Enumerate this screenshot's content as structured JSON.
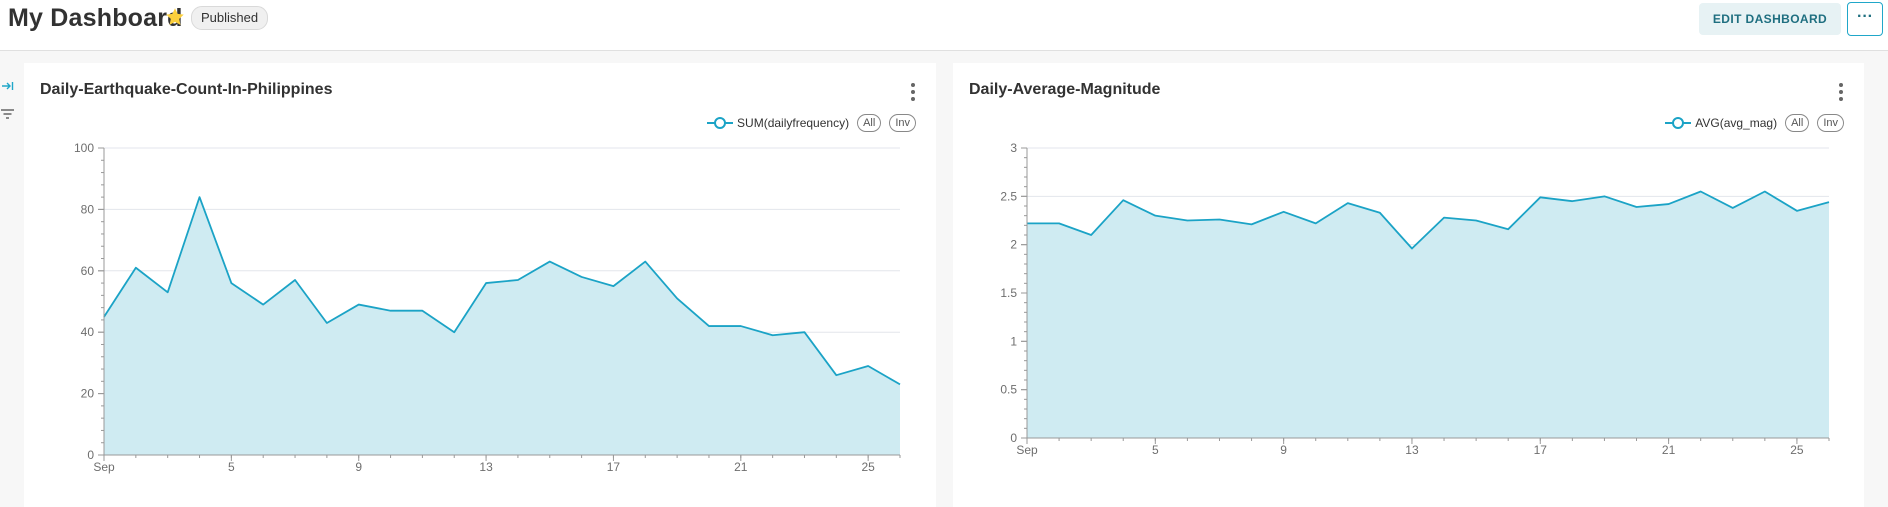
{
  "header": {
    "title": "My Dashboard",
    "status_badge": "Published",
    "edit_button": "EDIT DASHBOARD",
    "more_button": "···"
  },
  "colors": {
    "line": "#1ba3c6",
    "area": "#cfebf2",
    "star": "#fccf3c",
    "grid": "#e3e6ec"
  },
  "chart_data": [
    {
      "type": "area",
      "title": "Daily-Earthquake-Count-In-Philippines",
      "legend": {
        "series": "SUM(dailyfrequency)",
        "all_label": "All",
        "inv_label": "Inv",
        "placement": "top-right"
      },
      "x": [
        "Sep 1",
        "Sep 2",
        "Sep 3",
        "Sep 4",
        "Sep 5",
        "Sep 6",
        "Sep 7",
        "Sep 8",
        "Sep 9",
        "Sep 10",
        "Sep 11",
        "Sep 12",
        "Sep 13",
        "Sep 14",
        "Sep 15",
        "Sep 16",
        "Sep 17",
        "Sep 18",
        "Sep 19",
        "Sep 20",
        "Sep 21",
        "Sep 22",
        "Sep 23",
        "Sep 24",
        "Sep 25",
        "Sep 26"
      ],
      "series": [
        {
          "name": "SUM(dailyfrequency)",
          "values": [
            45,
            61,
            53,
            84,
            56,
            49,
            57,
            43,
            49,
            47,
            47,
            40,
            56,
            57,
            63,
            58,
            55,
            63,
            51,
            42,
            42,
            39,
            40,
            26,
            29,
            23
          ]
        }
      ],
      "xticks": [
        {
          "index": 0,
          "label": "Sep"
        },
        {
          "index": 4,
          "label": "5"
        },
        {
          "index": 8,
          "label": "9"
        },
        {
          "index": 12,
          "label": "13"
        },
        {
          "index": 16,
          "label": "17"
        },
        {
          "index": 20,
          "label": "21"
        },
        {
          "index": 24,
          "label": "25"
        }
      ],
      "ylim": [
        0,
        100
      ],
      "yticks": [
        {
          "value": 0,
          "label": "0"
        },
        {
          "value": 20,
          "label": "20"
        },
        {
          "value": 40,
          "label": "40"
        },
        {
          "value": 60,
          "label": "60"
        },
        {
          "value": 80,
          "label": "80"
        },
        {
          "value": 100,
          "label": "100"
        }
      ],
      "grid": true
    },
    {
      "type": "area",
      "title": "Daily-Average-Magnitude",
      "legend": {
        "series": "AVG(avg_mag)",
        "all_label": "All",
        "inv_label": "Inv",
        "placement": "top-right"
      },
      "x": [
        "Sep 1",
        "Sep 2",
        "Sep 3",
        "Sep 4",
        "Sep 5",
        "Sep 6",
        "Sep 7",
        "Sep 8",
        "Sep 9",
        "Sep 10",
        "Sep 11",
        "Sep 12",
        "Sep 13",
        "Sep 14",
        "Sep 15",
        "Sep 16",
        "Sep 17",
        "Sep 18",
        "Sep 19",
        "Sep 20",
        "Sep 21",
        "Sep 22",
        "Sep 23",
        "Sep 24",
        "Sep 25",
        "Sep 26"
      ],
      "series": [
        {
          "name": "AVG(avg_mag)",
          "values": [
            2.22,
            2.22,
            2.1,
            2.46,
            2.3,
            2.25,
            2.26,
            2.21,
            2.34,
            2.22,
            2.43,
            2.33,
            1.96,
            2.28,
            2.25,
            2.16,
            2.49,
            2.45,
            2.5,
            2.39,
            2.42,
            2.55,
            2.38,
            2.55,
            2.35,
            2.44
          ]
        }
      ],
      "xticks": [
        {
          "index": 0,
          "label": "Sep"
        },
        {
          "index": 4,
          "label": "5"
        },
        {
          "index": 8,
          "label": "9"
        },
        {
          "index": 12,
          "label": "13"
        },
        {
          "index": 16,
          "label": "17"
        },
        {
          "index": 20,
          "label": "21"
        },
        {
          "index": 24,
          "label": "25"
        }
      ],
      "ylim": [
        0,
        3
      ],
      "yticks": [
        {
          "value": 0,
          "label": "0"
        },
        {
          "value": 0.5,
          "label": "0.5"
        },
        {
          "value": 1,
          "label": "1"
        },
        {
          "value": 1.5,
          "label": "1.5"
        },
        {
          "value": 2,
          "label": "2"
        },
        {
          "value": 2.5,
          "label": "2.5"
        },
        {
          "value": 3,
          "label": "3"
        }
      ],
      "grid": true
    }
  ]
}
